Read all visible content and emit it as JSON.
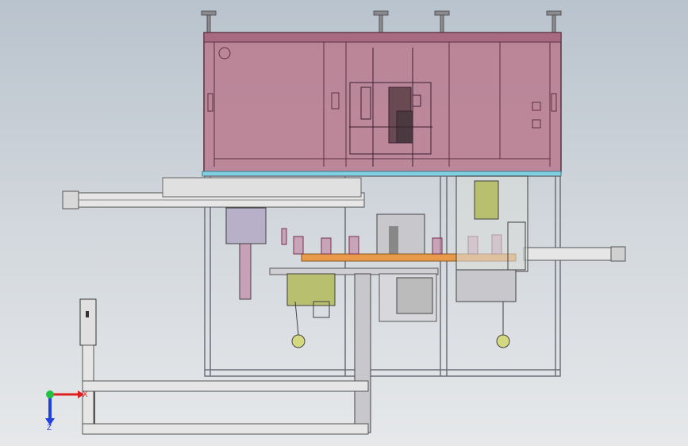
{
  "view": {
    "background_top": "#b9c3cd",
    "background_bottom": "#e6e8ea",
    "enclosure_color": "#b87a8e",
    "frame_color": "#6e6e78",
    "accent_strip_color": "#7fd0e0",
    "turret_plate_color": "#e89a4a",
    "motor_color": "#b8c070"
  },
  "triad": {
    "x_label": "X",
    "z_label": "Z",
    "x_color": "#e02020",
    "y_color": "#20c040",
    "z_color": "#2040e0"
  }
}
